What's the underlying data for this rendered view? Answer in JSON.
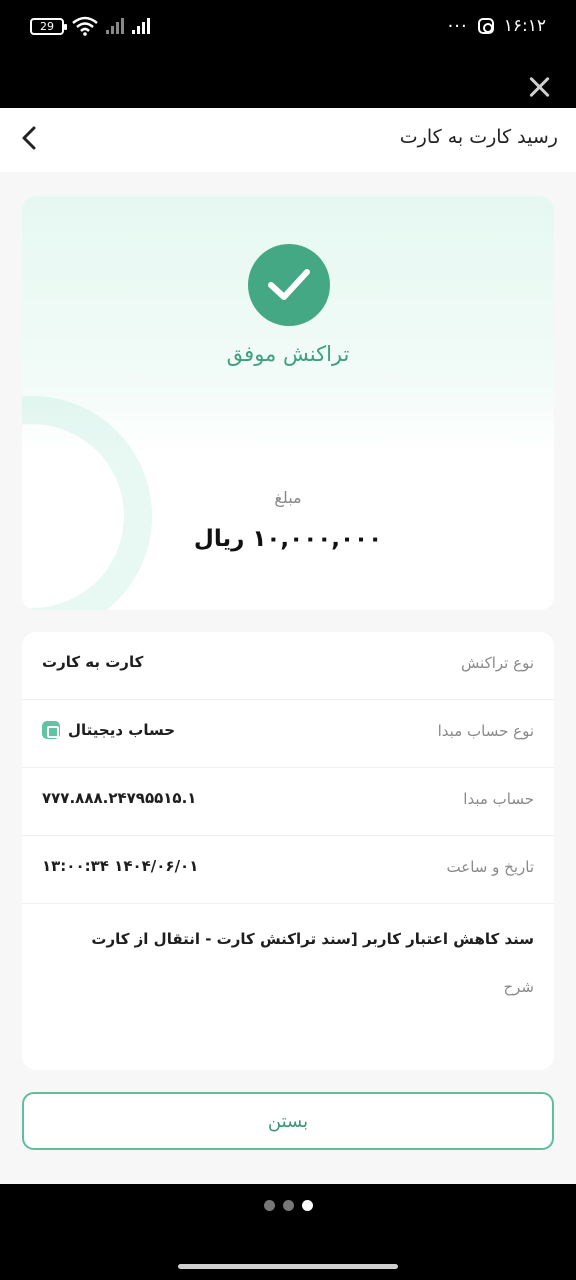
{
  "status_bar": {
    "battery": "29",
    "time": "۱۶:۱۲",
    "more": "···"
  },
  "header": {
    "title": "رسید کارت به کارت"
  },
  "receipt": {
    "status": "تراکنش موفق",
    "amount_label": "مبلغ",
    "amount_value": "۱۰,۰۰۰,۰۰۰ ریال"
  },
  "details": {
    "rows": [
      {
        "label": "نوع تراکنش",
        "value": "کارت به کارت"
      },
      {
        "label": "نوع حساب مبدا",
        "value": "حساب دیجیتال"
      },
      {
        "label": "حساب مبدا",
        "value": "۷۷۷.۸۸۸.۲۴۷۹۵۵۱۵.۱"
      },
      {
        "label": "تاریخ و ساعت",
        "value": "۱۴۰۴/۰۶/۰۱ ۱۳:۰۰:۳۴"
      }
    ],
    "description_value": "سند کاهش اعتبار کاربر [سند تراکنش کارت - انتقال از کارت",
    "description_label": "شرح"
  },
  "actions": {
    "close_label": "بستن"
  },
  "pager": {
    "count": 3,
    "active_index": 2
  },
  "colors": {
    "accent": "#43a883",
    "accent_text": "#3ea07d"
  }
}
